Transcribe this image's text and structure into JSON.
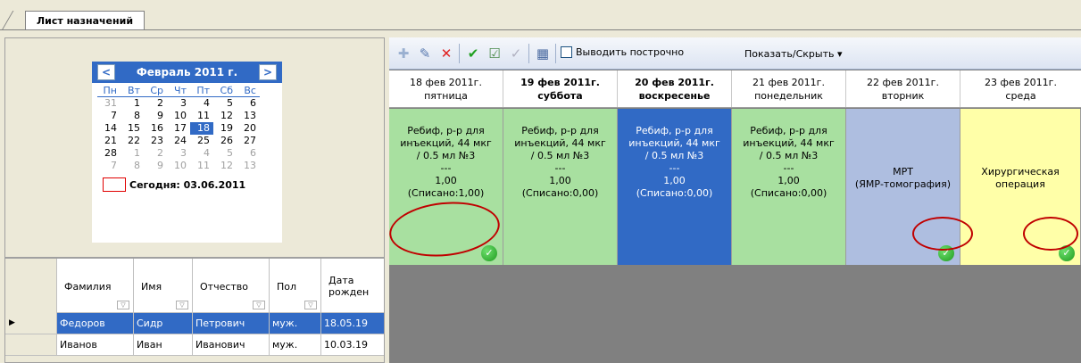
{
  "tab": {
    "label": "Лист назначений"
  },
  "calendar": {
    "month_label": "Февраль 2011 г.",
    "prev": "<",
    "next": ">",
    "dow": [
      "Пн",
      "Вт",
      "Ср",
      "Чт",
      "Пт",
      "Сб",
      "Вс"
    ],
    "weeks": [
      [
        "31",
        "1",
        "2",
        "3",
        "4",
        "5",
        "6"
      ],
      [
        "7",
        "8",
        "9",
        "10",
        "11",
        "12",
        "13"
      ],
      [
        "14",
        "15",
        "16",
        "17",
        "18",
        "19",
        "20"
      ],
      [
        "21",
        "22",
        "23",
        "24",
        "25",
        "26",
        "27"
      ],
      [
        "28",
        "1",
        "2",
        "3",
        "4",
        "5",
        "6"
      ],
      [
        "7",
        "8",
        "9",
        "10",
        "11",
        "12",
        "13"
      ]
    ],
    "today_label": "Сегодня: 03.06.2011"
  },
  "patients": {
    "columns": [
      "Фамилия",
      "Имя",
      "Отчество",
      "Пол",
      "Дата рожден"
    ],
    "rows": [
      [
        "Федоров",
        "Сидр",
        "Петрович",
        "муж.",
        "18.05.19"
      ],
      [
        "Иванов",
        "Иван",
        "Иванович",
        "муж.",
        "10.03.19"
      ]
    ]
  },
  "toolbar": {
    "add_icon": "add-icon",
    "edit_icon": "edit-icon",
    "delete_icon": "delete-icon",
    "confirm_icon": "checkmark-icon",
    "row_by_row_label": "Выводить построчно",
    "show_hide_label": "Показать/Скрыть ▾"
  },
  "schedule": {
    "days": [
      {
        "date": "18 фев 2011г.",
        "weekday": "пятница"
      },
      {
        "date": "19 фев 2011г.",
        "weekday": "суббота"
      },
      {
        "date": "20 фев 2011г.",
        "weekday": "воскресенье"
      },
      {
        "date": "21 фев 2011г.",
        "weekday": "понедельник"
      },
      {
        "date": "22 фев 2011г.",
        "weekday": "вторник"
      },
      {
        "date": "23 фев 2011г.",
        "weekday": "среда"
      }
    ],
    "cells": [
      {
        "l1": "Ребиф, р-р для",
        "l2": "инъекций, 44 мкг",
        "l3": "/ 0.5 мл №3",
        "l4": "---",
        "l5": "1,00",
        "l6": "(Списано:1,00)"
      },
      {
        "l1": "Ребиф, р-р для",
        "l2": "инъекций, 44 мкг",
        "l3": "/ 0.5 мл №3",
        "l4": "---",
        "l5": "1,00",
        "l6": "(Списано:0,00)"
      },
      {
        "l1": "Ребиф, р-р для",
        "l2": "инъекций, 44 мкг",
        "l3": "/ 0.5 мл №3",
        "l4": "---",
        "l5": "1,00",
        "l6": "(Списано:0,00)"
      },
      {
        "l1": "Ребиф, р-р для",
        "l2": "инъекций, 44 мкг",
        "l3": "/ 0.5 мл №3",
        "l4": "---",
        "l5": "1,00",
        "l6": "(Списано:0,00)"
      },
      {
        "l1": "МРТ",
        "l2": "(ЯМР-томография)"
      },
      {
        "l1": "Хирургическая",
        "l2": "операция"
      }
    ],
    "done_mark": "✓"
  },
  "colors": {
    "selected": "#316ac5",
    "green_cell": "#a8e0a0",
    "lavender_cell": "#aebee0",
    "yellow_cell": "#ffffa8",
    "annotation": "#c00000"
  }
}
